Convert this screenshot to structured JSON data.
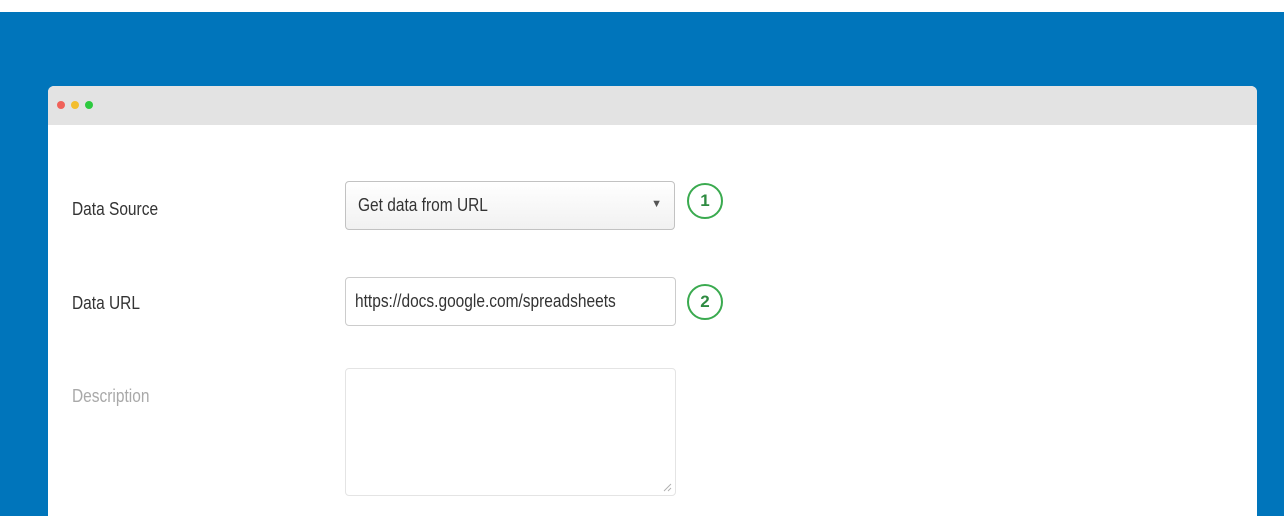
{
  "window": {
    "controls": [
      "close",
      "minimize",
      "maximize"
    ]
  },
  "form": {
    "data_source": {
      "label": "Data Source",
      "selected": "Get data from URL",
      "step": "1"
    },
    "data_url": {
      "label": "Data URL",
      "value": "https://docs.google.com/spreadsheets",
      "step": "2"
    },
    "description": {
      "label": "Description",
      "value": ""
    }
  },
  "colors": {
    "background": "#0075bb",
    "badge_border": "#3aaa4f"
  }
}
